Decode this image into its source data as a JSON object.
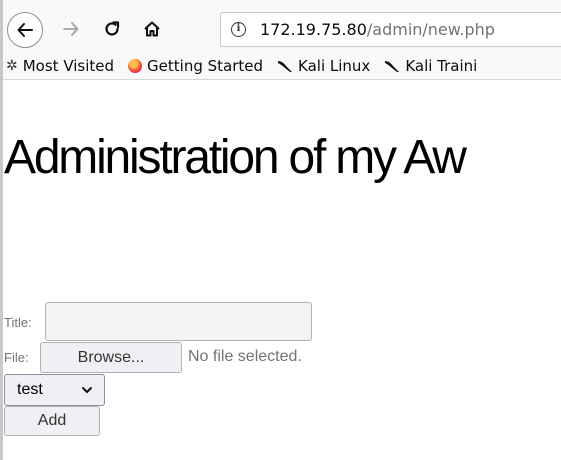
{
  "browser": {
    "url_host": "172.19.75.80",
    "url_path": "/admin/new.php"
  },
  "bookmarks": [
    {
      "label": "Most Visited",
      "icon": "gear-icon"
    },
    {
      "label": "Getting Started",
      "icon": "firefox-icon"
    },
    {
      "label": "Kali Linux",
      "icon": "kali-dragon-icon"
    },
    {
      "label": "Kali Traini",
      "icon": "kali-dragon-icon"
    }
  ],
  "page": {
    "title": "Administration of my Aw"
  },
  "form": {
    "title_label": "Title:",
    "title_value": "",
    "file_label": "File:",
    "browse_label": "Browse...",
    "file_status": "No file selected.",
    "select_value": "test",
    "add_label": "Add"
  }
}
